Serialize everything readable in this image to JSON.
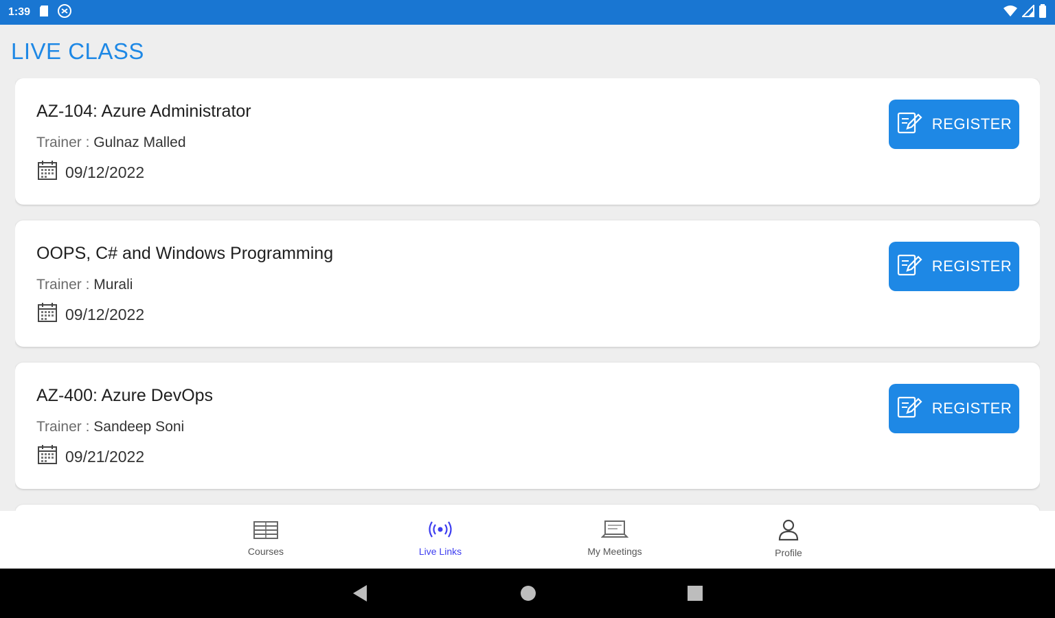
{
  "status_bar": {
    "time": "1:39"
  },
  "page": {
    "title": "LIVE CLASS"
  },
  "classes": [
    {
      "title": "AZ-104: Azure Administrator",
      "trainer_label": "Trainer :",
      "trainer": "Gulnaz Malled",
      "date": "09/12/2022",
      "register_label": "REGISTER"
    },
    {
      "title": "OOPS, C# and Windows Programming",
      "trainer_label": "Trainer :",
      "trainer": "Murali",
      "date": "09/12/2022",
      "register_label": "REGISTER"
    },
    {
      "title": "AZ-400: Azure DevOps",
      "trainer_label": "Trainer :",
      "trainer": "Sandeep Soni",
      "date": "09/21/2022",
      "register_label": "REGISTER"
    }
  ],
  "bottom_nav": {
    "items": [
      {
        "label": "Courses",
        "icon": "books-icon"
      },
      {
        "label": "Live Links",
        "icon": "broadcast-icon",
        "active": true
      },
      {
        "label": "My Meetings",
        "icon": "laptop-meeting-icon"
      },
      {
        "label": "Profile",
        "icon": "person-icon"
      }
    ]
  },
  "colors": {
    "status_bar": "#1976d2",
    "accent": "#1e88e5",
    "active_nav": "#3d3df0"
  }
}
